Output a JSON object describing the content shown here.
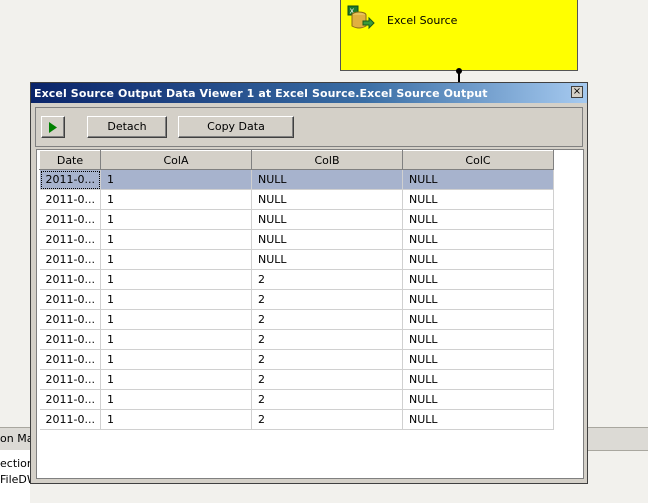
{
  "component": {
    "label": "Excel Source",
    "icon": "excel-source-icon",
    "color": "#ffff00"
  },
  "background_pane": {
    "title": "on Mar",
    "items": [
      "ection",
      "FileDW"
    ]
  },
  "dialog": {
    "title": "Excel Source Output Data Viewer 1 at Excel Source.Excel Source Output",
    "close_label": "×",
    "toolbar": {
      "detach_label": "Detach",
      "copy_label": "Copy Data"
    },
    "grid": {
      "columns": [
        "Date",
        "ColA",
        "ColB",
        "ColC"
      ],
      "rows": [
        [
          "2011-0...",
          "1",
          "NULL",
          "NULL"
        ],
        [
          "2011-0...",
          "1",
          "NULL",
          "NULL"
        ],
        [
          "2011-0...",
          "1",
          "NULL",
          "NULL"
        ],
        [
          "2011-0...",
          "1",
          "NULL",
          "NULL"
        ],
        [
          "2011-0...",
          "1",
          "NULL",
          "NULL"
        ],
        [
          "2011-0...",
          "1",
          "2",
          "NULL"
        ],
        [
          "2011-0...",
          "1",
          "2",
          "NULL"
        ],
        [
          "2011-0...",
          "1",
          "2",
          "NULL"
        ],
        [
          "2011-0...",
          "1",
          "2",
          "NULL"
        ],
        [
          "2011-0...",
          "1",
          "2",
          "NULL"
        ],
        [
          "2011-0...",
          "1",
          "2",
          "NULL"
        ],
        [
          "2011-0...",
          "1",
          "2",
          "NULL"
        ],
        [
          "2011-0...",
          "1",
          "2",
          "NULL"
        ]
      ],
      "selected_row": 0,
      "selection_color": "#a7b3cd"
    }
  },
  "colors": {
    "titlebar_start": "#0a246a",
    "titlebar_end": "#a6caf0",
    "window_face": "#d4d0c8"
  }
}
